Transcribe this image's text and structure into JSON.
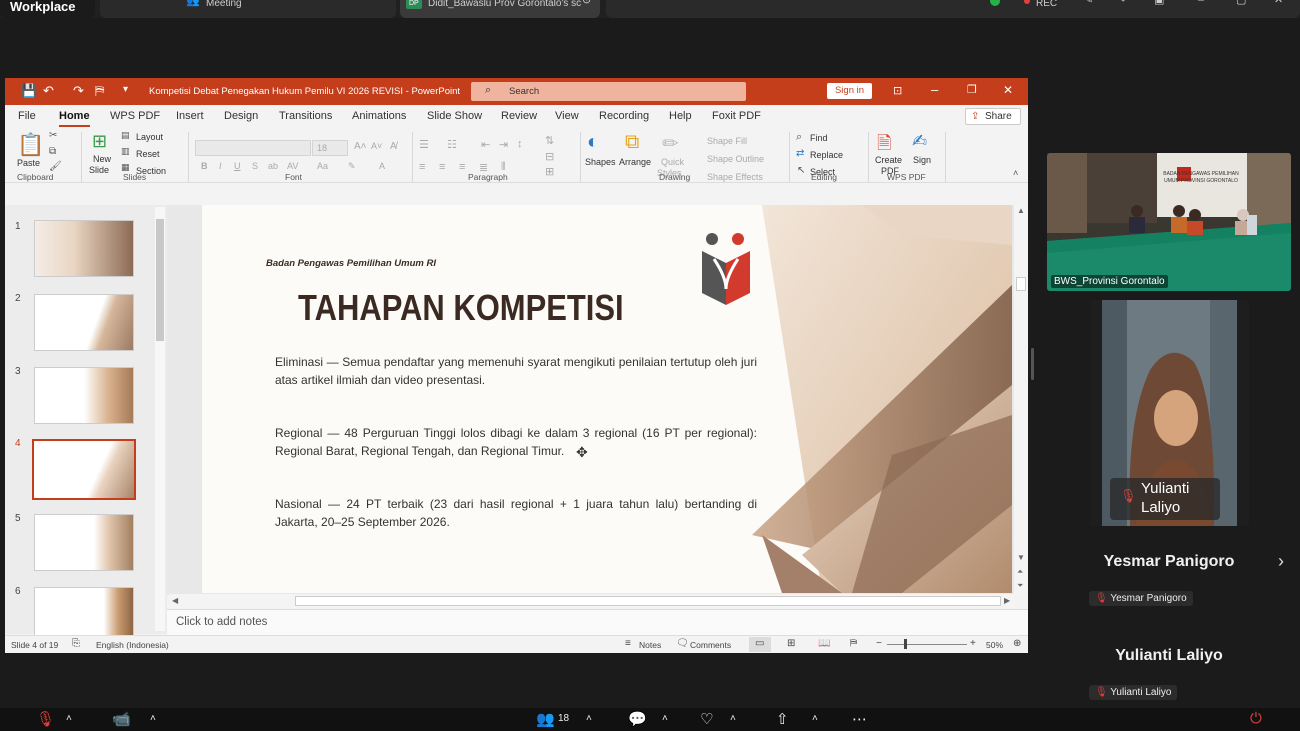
{
  "meeting": {
    "app_title": "Workplace",
    "tab_meeting": "Meeting",
    "tab_share": "Didit_Bawaslu Prov Gorontalo's sc",
    "share_badge": "DP",
    "rec_label": "REC",
    "participants_count": "18"
  },
  "ppt": {
    "window_title": "Kompetisi Debat Penegakan Hukum Pemilu VI 2026 REVISI  -  PowerPoint",
    "search_placeholder": "Search",
    "sign_in": "Sign in",
    "share": "Share",
    "tabs": [
      "File",
      "Home",
      "WPS PDF",
      "Insert",
      "Design",
      "Transitions",
      "Animations",
      "Slide Show",
      "Review",
      "View",
      "Recording",
      "Help",
      "Foxit PDF"
    ],
    "ribbon": {
      "paste": "Paste",
      "new_slide_1": "New",
      "new_slide_2": "Slide",
      "layout": "Layout",
      "reset": "Reset",
      "section": "Section",
      "font_size": "18",
      "shapes": "Shapes",
      "arrange": "Arrange",
      "quick_styles_1": "Quick",
      "quick_styles_2": "Styles",
      "shape_fill": "Shape Fill",
      "shape_outline": "Shape Outline",
      "shape_effects": "Shape Effects",
      "find": "Find",
      "replace": "Replace",
      "select": "Select",
      "create_pdf_1": "Create",
      "create_pdf_2": "PDF",
      "sign": "Sign",
      "groups": {
        "clipboard": "Clipboard",
        "slides": "Slides",
        "font": "Font",
        "paragraph": "Paragraph",
        "drawing": "Drawing",
        "editing": "Editing",
        "wps_pdf": "WPS PDF"
      }
    },
    "thumb_numbers": [
      "1",
      "2",
      "3",
      "4",
      "5",
      "6"
    ],
    "slide": {
      "org": "Badan Pengawas Pemilihan Umum RI",
      "title": "TAHAPAN KOMPETISI",
      "p1": "Eliminasi — Semua pendaftar yang memenuhi syarat mengikuti penilaian tertutup oleh juri atas artikel ilmiah dan video presentasi.",
      "p2": "Regional — 48 Perguruan Tinggi lolos dibagi ke dalam 3 regional (16 PT per regional): Regional Barat, Regional Tengah, dan Regional Timur.",
      "p3": "Nasional — 24 PT terbaik (23 dari hasil regional + 1 juara tahun lalu) bertanding di Jakarta, 20–25 September 2026."
    },
    "notes_placeholder": "Click to add notes",
    "status": {
      "slide_of": "Slide 4 of 19",
      "language": "English (Indonesia)",
      "notes": "Notes",
      "comments": "Comments",
      "zoom": "50%"
    }
  },
  "participants": {
    "room_label": "BWS_Provinsi Gorontalo",
    "room_banner": "BADAN PENGAWAS PEMILIHAN UMUM PROVINSI GORONTALO",
    "yulianti_tile_1": "Yulianti",
    "yulianti_tile_2": "Laliyo",
    "yesmar_name": "Yesmar Panigoro",
    "yesmar_tag": "Yesmar Panigoro",
    "yulianti_name": "Yulianti Laliyo",
    "yulianti_tag": "Yulianti Laliyo"
  }
}
